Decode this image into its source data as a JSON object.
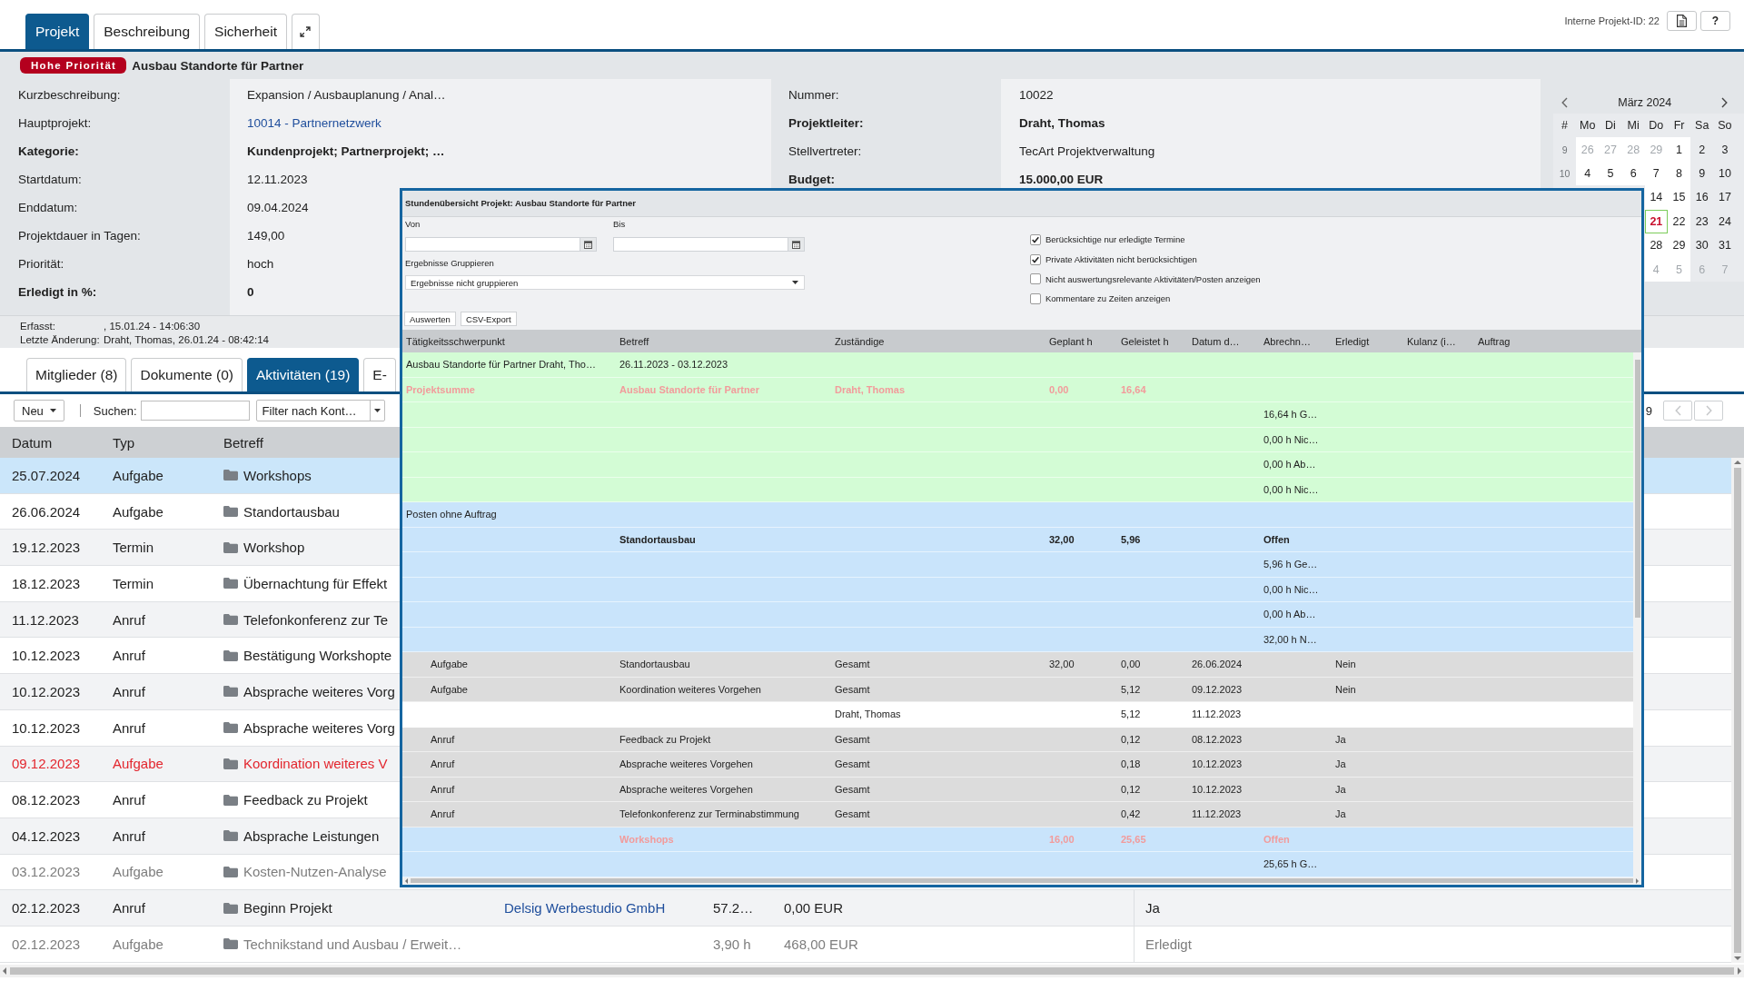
{
  "tabs": [
    {
      "label": "Projekt",
      "selected": true
    },
    {
      "label": "Beschreibung",
      "selected": false
    },
    {
      "label": "Sicherheit",
      "selected": false
    }
  ],
  "header": {
    "project_id": "Interne Projekt-ID: 22",
    "help": "?"
  },
  "title_bar": {
    "badge": "Hohe Priorität",
    "title": "Ausbau Standorte für Partner"
  },
  "details": {
    "left": [
      {
        "label": "Kurzbeschreibung:",
        "value": "Expansion / Ausbauplanung / Anal…",
        "kind": "text",
        "emphasis": false
      },
      {
        "label": "Hauptprojekt:",
        "value": "10014 - Partnernetzwerk",
        "kind": "link",
        "emphasis": false
      },
      {
        "label": "Kategorie:",
        "value": "Kundenprojekt; Partnerprojekt; …",
        "kind": "text",
        "emphasis": true
      },
      {
        "label": "Startdatum:",
        "value": "12.11.2023",
        "kind": "text",
        "emphasis": false
      },
      {
        "label": "Enddatum:",
        "value": "09.04.2024",
        "kind": "text",
        "emphasis": false
      },
      {
        "label": "Projektdauer in Tagen:",
        "value": "149,00",
        "kind": "text",
        "emphasis": false
      },
      {
        "label": "Priorität:",
        "value": "hoch",
        "kind": "text",
        "emphasis": false
      },
      {
        "label": "Erledigt in %:",
        "value": "0",
        "kind": "text",
        "emphasis": true
      }
    ],
    "right": [
      {
        "label": "Nummer:",
        "value": "10022",
        "kind": "text",
        "emphasis": false
      },
      {
        "label": "Projektleiter:",
        "value": "Draht, Thomas",
        "kind": "text",
        "emphasis": true
      },
      {
        "label": "Stellvertreter:",
        "value": "TecArt Projektverwaltung",
        "kind": "text",
        "emphasis": false
      },
      {
        "label": "Budget:",
        "value": "15.000,00 EUR",
        "kind": "text",
        "emphasis": true
      }
    ]
  },
  "calendar": {
    "month": "März 2024",
    "weekdays": [
      "#",
      "Mo",
      "Di",
      "Mi",
      "Do",
      "Fr",
      "Sa",
      "So"
    ],
    "weeks": [
      {
        "number": "9",
        "days": [
          {
            "day": "26",
            "muted": true,
            "today": false
          },
          {
            "day": "27",
            "muted": true,
            "today": false
          },
          {
            "day": "28",
            "muted": true,
            "today": false
          },
          {
            "day": "29",
            "muted": true,
            "today": false
          },
          {
            "day": "1",
            "muted": false,
            "today": false
          },
          {
            "day": "2",
            "muted": false,
            "today": false
          },
          {
            "day": "3",
            "muted": false,
            "today": false
          }
        ]
      },
      {
        "number": "10",
        "days": [
          {
            "day": "4",
            "muted": false,
            "today": false
          },
          {
            "day": "5",
            "muted": false,
            "today": false
          },
          {
            "day": "6",
            "muted": false,
            "today": false
          },
          {
            "day": "7",
            "muted": false,
            "today": false
          },
          {
            "day": "8",
            "muted": false,
            "today": false
          },
          {
            "day": "9",
            "muted": false,
            "today": false
          },
          {
            "day": "10",
            "muted": false,
            "today": false
          }
        ]
      },
      {
        "days": [
          {
            "day": "14",
            "muted": false,
            "today": false
          },
          {
            "day": "15",
            "muted": false,
            "today": false
          },
          {
            "day": "16",
            "muted": false,
            "today": false
          },
          {
            "day": "17",
            "muted": false,
            "today": false
          }
        ]
      },
      {
        "days": [
          {
            "day": "21",
            "muted": false,
            "today": true
          },
          {
            "day": "22",
            "muted": false,
            "today": false
          },
          {
            "day": "23",
            "muted": false,
            "today": false
          },
          {
            "day": "24",
            "muted": false,
            "today": false
          }
        ]
      },
      {
        "days": [
          {
            "day": "28",
            "muted": false,
            "today": false
          },
          {
            "day": "29",
            "muted": false,
            "today": false
          },
          {
            "day": "30",
            "muted": false,
            "today": false
          },
          {
            "day": "31",
            "muted": false,
            "today": false
          }
        ]
      },
      {
        "days": [
          {
            "day": "4",
            "muted": true,
            "today": false
          },
          {
            "day": "5",
            "muted": true,
            "today": false
          },
          {
            "day": "6",
            "muted": true,
            "today": false
          },
          {
            "day": "7",
            "muted": true,
            "today": false
          }
        ]
      }
    ]
  },
  "record_info": [
    {
      "label": "Erfasst:",
      "value": ", 15.01.24 - 14:06:30"
    },
    {
      "label": "Letzte Änderung:",
      "value": "Draht, Thomas, 26.01.24 - 08:42:14"
    }
  ],
  "subtabs": [
    {
      "label": "Mitglieder (8)",
      "selected": false
    },
    {
      "label": "Dokumente (0)",
      "selected": false
    },
    {
      "label": "Aktivitäten (19)",
      "selected": true
    },
    {
      "label": "E-",
      "selected": false
    }
  ],
  "toolbar": {
    "new_button": "Neu",
    "search_label": "Suchen:",
    "filter": "Filter nach Kont…",
    "pager_text": "9",
    "pager_disabled": true
  },
  "list": {
    "columns": [
      "Datum",
      "Typ",
      "Betreff"
    ],
    "rows": [
      {
        "date": "25.07.2024",
        "type": "Aufgabe",
        "subject": "Workshops",
        "selected": true,
        "overdue": false,
        "done": false
      },
      {
        "date": "26.06.2024",
        "type": "Aufgabe",
        "subject": "Standortausbau",
        "selected": false,
        "overdue": false,
        "done": false
      },
      {
        "date": "19.12.2023",
        "type": "Termin",
        "subject": "Workshop",
        "selected": false,
        "overdue": false,
        "done": false
      },
      {
        "date": "18.12.2023",
        "type": "Termin",
        "subject": "Übernachtung für Effekt",
        "selected": false,
        "overdue": false,
        "done": false
      },
      {
        "date": "11.12.2023",
        "type": "Anruf",
        "subject": "Telefonkonferenz zur Te",
        "selected": false,
        "overdue": false,
        "done": false
      },
      {
        "date": "10.12.2023",
        "type": "Anruf",
        "subject": "Bestätigung Workshopte",
        "selected": false,
        "overdue": false,
        "done": false
      },
      {
        "date": "10.12.2023",
        "type": "Anruf",
        "subject": "Absprache weiteres Vorg",
        "selected": false,
        "overdue": false,
        "done": false
      },
      {
        "date": "10.12.2023",
        "type": "Anruf",
        "subject": "Absprache weiteres Vorg",
        "selected": false,
        "overdue": false,
        "done": false
      },
      {
        "date": "09.12.2023",
        "type": "Aufgabe",
        "subject": "Koordination weiteres V",
        "selected": false,
        "overdue": true,
        "done": false
      },
      {
        "date": "08.12.2023",
        "type": "Anruf",
        "subject": "Feedback zu Projekt",
        "selected": false,
        "overdue": false,
        "done": false
      },
      {
        "date": "04.12.2023",
        "type": "Anruf",
        "subject": "Absprache Leistungen",
        "selected": false,
        "overdue": false,
        "done": false
      },
      {
        "date": "03.12.2023",
        "type": "Aufgabe",
        "subject": "Kosten-Nutzen-Analyse",
        "selected": false,
        "overdue": false,
        "done": true
      },
      {
        "date": "02.12.2023",
        "type": "Anruf",
        "subject": "Beginn Projekt",
        "column_4": "Delsig Werbestudio GmbH",
        "column_5": "57.2…",
        "column_6": "0,00 EUR",
        "column_7": "Ja",
        "selected": false,
        "overdue": false,
        "done": false
      },
      {
        "date": "02.12.2023",
        "type": "Aufgabe",
        "subject": "Technikstand und Ausbau / Erweit…",
        "column_5": "3,90 h",
        "column_6": "468,00 EUR",
        "column_7": "Erledigt",
        "selected": false,
        "overdue": false,
        "done": true
      }
    ]
  },
  "dialog": {
    "title": "Stundenübersicht Projekt: Ausbau Standorte für Partner",
    "from_label": "Von",
    "to_label": "Bis",
    "group_label": "Ergebnisse Gruppieren",
    "group_value": "Ergebnisse nicht gruppieren",
    "options": [
      {
        "label": "Berücksichtige nur erledigte Termine",
        "checked": true
      },
      {
        "label": "Private Aktivitäten nicht berücksichtigen",
        "checked": true
      },
      {
        "label": "Nicht auswertungsrelevante Aktivitäten/Posten anzeigen",
        "checked": false
      },
      {
        "label": "Kommentare zu Zeiten anzeigen",
        "checked": false
      }
    ],
    "buttons": [
      "Auswerten",
      "CSV-Export"
    ],
    "columns": [
      "Tätigkeitsschwerpunkt",
      "Betreff",
      "Zuständige",
      "Geplant h",
      "Geleistet h",
      "Datum d…",
      "Abrechn…",
      "Erledigt",
      "Kulanz (i…",
      "Auftrag"
    ],
    "rows": [
      {
        "kind": "project",
        "focus": "Ausbau Standorte für Partner Draht, Tho…",
        "subject": "26.11.2023 - 03.12.2023"
      },
      {
        "kind": "project-total",
        "exceeded": true,
        "focus": "Projektsumme",
        "subject": "Ausbau Standorte für Partner",
        "assignee": "Draht, Thomas",
        "planned": "0,00",
        "done": "16,64"
      },
      {
        "kind": "project-detail",
        "column_7": "16,64 h G…"
      },
      {
        "kind": "project-detail",
        "column_7": "0,00 h Nic…"
      },
      {
        "kind": "project-detail",
        "column_7": "0,00 h Ab…"
      },
      {
        "kind": "project-detail",
        "column_7": "0,00 h Nic…"
      },
      {
        "kind": "order",
        "focus": "Posten ohne Auftrag"
      },
      {
        "kind": "order-total",
        "exceeded": false,
        "subject": "Standortausbau",
        "planned": "32,00",
        "done": "5,96",
        "column_7": "Offen"
      },
      {
        "kind": "order-detail",
        "column_7": "5,96 h Ge…"
      },
      {
        "kind": "order-detail",
        "column_7": "0,00 h Nic…"
      },
      {
        "kind": "order-detail",
        "column_7": "0,00 h Ab…"
      },
      {
        "kind": "order-detail",
        "column_7": "32,00 h N…"
      },
      {
        "kind": "activity",
        "focus": "Aufgabe",
        "subject": "Standortausbau",
        "assignee": "Gesamt",
        "planned": "32,00",
        "done": "0,00",
        "column_6": "26.06.2024",
        "completed": "Nein"
      },
      {
        "kind": "activity",
        "focus": "Aufgabe",
        "subject": "Koordination weiteres Vorgehen",
        "assignee": "Gesamt",
        "done": "5,12",
        "column_6": "09.12.2023",
        "completed": "Nein"
      },
      {
        "kind": "assignee",
        "assignee": "Draht, Thomas",
        "done": "5,12",
        "column_6": "11.12.2023"
      },
      {
        "kind": "activity",
        "focus": "Anruf",
        "subject": "Feedback zu Projekt",
        "assignee": "Gesamt",
        "done": "0,12",
        "column_6": "08.12.2023",
        "completed": "Ja"
      },
      {
        "kind": "activity",
        "focus": "Anruf",
        "subject": "Absprache weiteres Vorgehen",
        "assignee": "Gesamt",
        "done": "0,18",
        "column_6": "10.12.2023",
        "completed": "Ja"
      },
      {
        "kind": "activity",
        "focus": "Anruf",
        "subject": "Absprache weiteres Vorgehen",
        "assignee": "Gesamt",
        "done": "0,12",
        "column_6": "10.12.2023",
        "completed": "Ja"
      },
      {
        "kind": "activity",
        "focus": "Anruf",
        "subject": "Telefonkonferenz zur Terminabstimmung",
        "assignee": "Gesamt",
        "done": "0,42",
        "column_6": "11.12.2023",
        "completed": "Ja"
      },
      {
        "kind": "order-total",
        "exceeded": true,
        "subject": "Workshops",
        "planned": "16,00",
        "done": "25,65",
        "column_7": "Offen"
      },
      {
        "kind": "order-detail",
        "column_7": "25,65 h G…"
      }
    ]
  }
}
